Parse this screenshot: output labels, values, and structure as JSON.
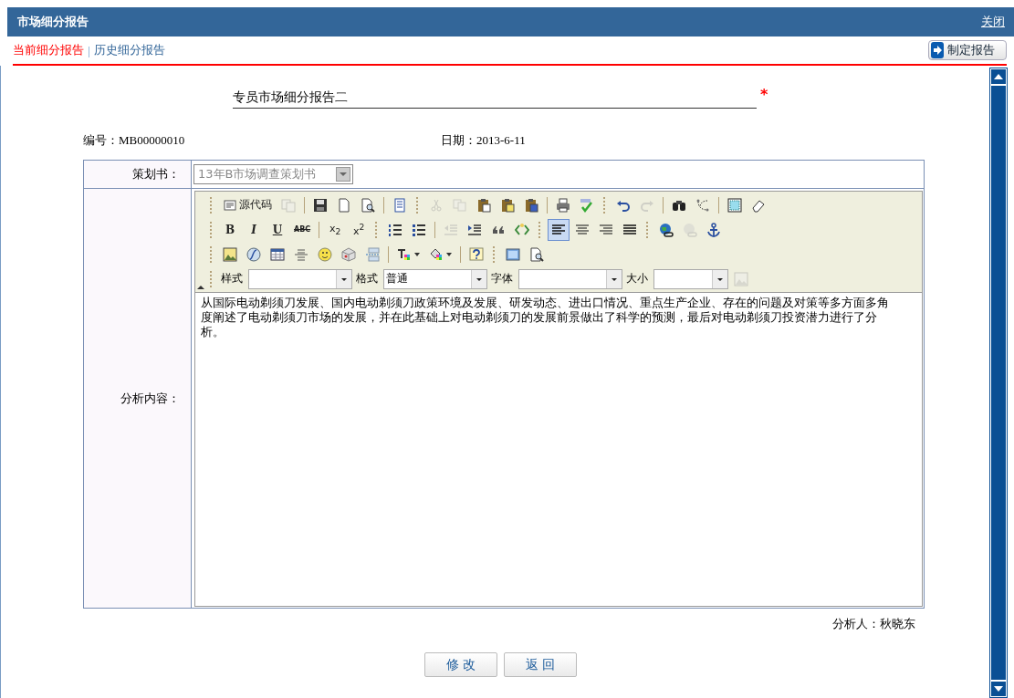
{
  "window": {
    "title": "市场细分报告",
    "close_link": "关闭"
  },
  "tabs": [
    {
      "label": "当前细分报告",
      "selected": true
    },
    {
      "label": "历史细分报告",
      "selected": false
    }
  ],
  "create_button": "制定报告",
  "report_title": {
    "value": "专员市场细分报告二",
    "required_mark": "*"
  },
  "info": {
    "number": "编号：MB00000010",
    "date": "日期：2013-6-11"
  },
  "plan": {
    "label": "策划书：",
    "value": "13年B市场调查策划书",
    "disabled": true
  },
  "content_label": "分析内容：",
  "toolbar": {
    "rows": [
      {
        "items": [
          {
            "kind": "text",
            "label": "源代码",
            "disabled": false
          },
          {
            "kind": "tool",
            "disabled": true
          },
          {
            "kind": "sep"
          },
          {
            "kind": "tool",
            "disabled": false
          },
          {
            "kind": "tool",
            "disabled": false
          },
          {
            "kind": "tool",
            "disabled": false
          },
          {
            "kind": "sep"
          },
          {
            "kind": "tool",
            "disabled": false
          },
          {
            "kind": "dotsep"
          },
          {
            "kind": "tool",
            "disabled": true
          },
          {
            "kind": "tool",
            "disabled": true
          },
          {
            "kind": "tool",
            "disabled": false
          },
          {
            "kind": "tool",
            "disabled": false
          },
          {
            "kind": "tool",
            "disabled": false
          },
          {
            "kind": "sep"
          },
          {
            "kind": "tool",
            "disabled": false
          },
          {
            "kind": "tool",
            "disabled": false
          },
          {
            "kind": "dotsep"
          },
          {
            "kind": "tool",
            "disabled": false
          },
          {
            "kind": "tool",
            "disabled": true
          },
          {
            "kind": "sep"
          },
          {
            "kind": "tool",
            "disabled": false
          },
          {
            "kind": "tool",
            "disabled": false
          },
          {
            "kind": "sep"
          },
          {
            "kind": "tool",
            "disabled": false
          },
          {
            "kind": "tool",
            "disabled": false
          }
        ]
      },
      {
        "items": [
          {
            "kind": "text",
            "label": "B",
            "disabled": false,
            "selected": false
          },
          {
            "kind": "text",
            "label": "I",
            "disabled": false,
            "selected": false
          },
          {
            "kind": "text",
            "label": "U",
            "disabled": false,
            "selected": false
          },
          {
            "kind": "text",
            "label": "ABC",
            "disabled": false,
            "selected": false
          },
          {
            "kind": "sep"
          },
          {
            "kind": "text",
            "label": "x$_{2}$",
            "disabled": false,
            "selected": false
          },
          {
            "kind": "text",
            "label": "x$^{2}$",
            "disabled": false,
            "selected": false
          },
          {
            "kind": "dotsep"
          },
          {
            "kind": "tool",
            "disabled": false,
            "selected": false
          },
          {
            "kind": "tool",
            "disabled": false,
            "selected": false
          },
          {
            "kind": "sep"
          },
          {
            "kind": "tool",
            "disabled": true,
            "selected": false
          },
          {
            "kind": "tool",
            "disabled": false,
            "selected": false
          },
          {
            "kind": "tool",
            "disabled": false,
            "selected": false
          },
          {
            "kind": "tool",
            "disabled": false,
            "selected": false
          },
          {
            "kind": "dotsep"
          },
          {
            "kind": "tool",
            "disabled": false,
            "selected": true
          },
          {
            "kind": "tool",
            "disabled": false,
            "selected": false
          },
          {
            "kind": "tool",
            "disabled": false,
            "selected": false
          },
          {
            "kind": "tool",
            "disabled": false,
            "selected": false
          },
          {
            "kind": "dotsep"
          },
          {
            "kind": "tool",
            "disabled": false,
            "selected": false
          },
          {
            "kind": "tool",
            "disabled": true,
            "selected": false
          },
          {
            "kind": "tool",
            "disabled": false,
            "selected": false
          }
        ]
      },
      {
        "items": [
          {
            "kind": "tool",
            "disabled": false
          },
          {
            "kind": "tool",
            "disabled": false
          },
          {
            "kind": "tool",
            "disabled": false
          },
          {
            "kind": "tool",
            "disabled": false
          },
          {
            "kind": "tool",
            "disabled": false
          },
          {
            "kind": "tool",
            "disabled": false
          },
          {
            "kind": "tool",
            "disabled": false
          },
          {
            "kind": "sep"
          },
          {
            "kind": "menu",
            "disabled": false
          },
          {
            "kind": "menu",
            "disabled": false
          },
          {
            "kind": "sep"
          },
          {
            "kind": "tool",
            "disabled": false
          },
          {
            "kind": "dotsep"
          },
          {
            "kind": "tool",
            "disabled": false
          },
          {
            "kind": "tool",
            "disabled": false
          }
        ]
      }
    ],
    "selects": [
      {
        "label": "样式"
      },
      {
        "label": "格式",
        "value": "普通"
      },
      {
        "label": "字体"
      },
      {
        "label": "大小"
      }
    ],
    "image_button": {
      "disabled": true
    }
  },
  "content": "从国际电动剃须刀发展、国内电动剃须刀政策环境及发展、研发动态、进出口情况、重点生产企业、存在的问题及对策等多方面多角度阐述了电动剃须刀市场的发展，并在此基础上对电动剃须刀的发展前景做出了科学的预测，最后对电动剃须刀投资潜力进行了分析。",
  "analyst": "分析人：秋晓东",
  "buttons": [
    "修 改",
    "返 回"
  ]
}
